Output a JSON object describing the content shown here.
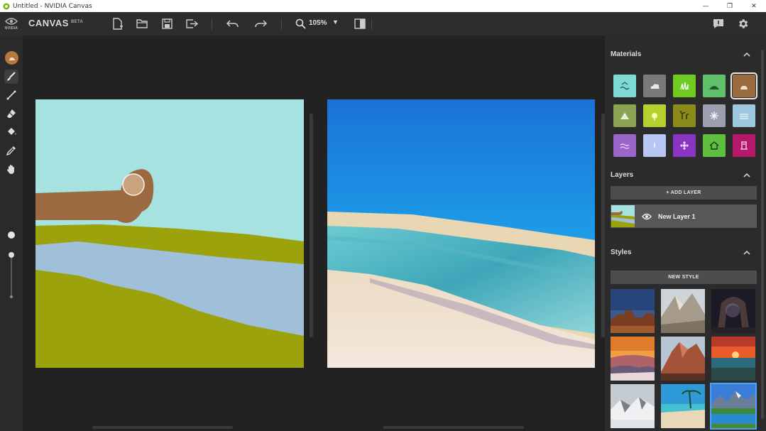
{
  "window": {
    "title": "Untitled - NVIDIA Canvas",
    "minimize_glyph": "—",
    "maximize_glyph": "❐",
    "close_glyph": "✕"
  },
  "brand": {
    "logo_text": "NVIDIA",
    "name": "CANVAS",
    "badge": "BETA"
  },
  "toolbar": {
    "icons": [
      "new-file-icon",
      "open-folder-icon",
      "save-icon",
      "export-icon",
      "undo-icon",
      "redo-icon",
      "zoom-icon",
      "compare-view-icon"
    ],
    "zoom_value": "105%",
    "zoom_caret": "▼",
    "right_icons": [
      "notes-icon",
      "gear-icon"
    ]
  },
  "tools": {
    "items": [
      "material-picker-icon",
      "brush-icon",
      "line-icon",
      "eraser-icon",
      "fill-bucket-icon",
      "eyedropper-icon",
      "pan-hand-icon"
    ],
    "active": "brush-icon",
    "brush_size": 0.0
  },
  "materials": {
    "title": "Materials",
    "collapse_glyph": "⌃",
    "items": [
      {
        "name": "sea",
        "color": "#7fd9d4"
      },
      {
        "name": "cloud",
        "color": "#7a7a7a"
      },
      {
        "name": "grass",
        "color": "#6fcb22"
      },
      {
        "name": "hill",
        "color": "#5fc06a"
      },
      {
        "name": "dirt",
        "color": "#9a6b3f"
      },
      {
        "name": "mountain",
        "color": "#8aa252"
      },
      {
        "name": "bush",
        "color": "#b5d12f"
      },
      {
        "name": "tree",
        "color": "#8b8b1c"
      },
      {
        "name": "snow",
        "color": "#9aa0ad"
      },
      {
        "name": "fog",
        "color": "#9ec8de"
      },
      {
        "name": "water",
        "color": "#9b66c9"
      },
      {
        "name": "sky",
        "color": "#b7c6f5"
      },
      {
        "name": "flower",
        "color": "#8a35c2"
      },
      {
        "name": "house",
        "color": "#5fbf3e"
      },
      {
        "name": "rock",
        "color": "#b5176b"
      }
    ],
    "selected_index": 4
  },
  "layers": {
    "title": "Layers",
    "add_label": "+ ADD LAYER",
    "items": [
      {
        "name": "New Layer 1"
      }
    ]
  },
  "styles": {
    "title": "Styles",
    "new_label": "NEW STYLE",
    "thumbs": [
      "desert-mesa-dusk",
      "rocky-peak",
      "night-arch",
      "sunset-clouds",
      "red-rock-mountain",
      "ocean-sunset",
      "snowy-ridge",
      "tropical-beach",
      "alpine-lake"
    ],
    "selected_index": 8
  },
  "colors": {
    "accent": "#76b900",
    "selected_style": "#4aa3ff"
  }
}
